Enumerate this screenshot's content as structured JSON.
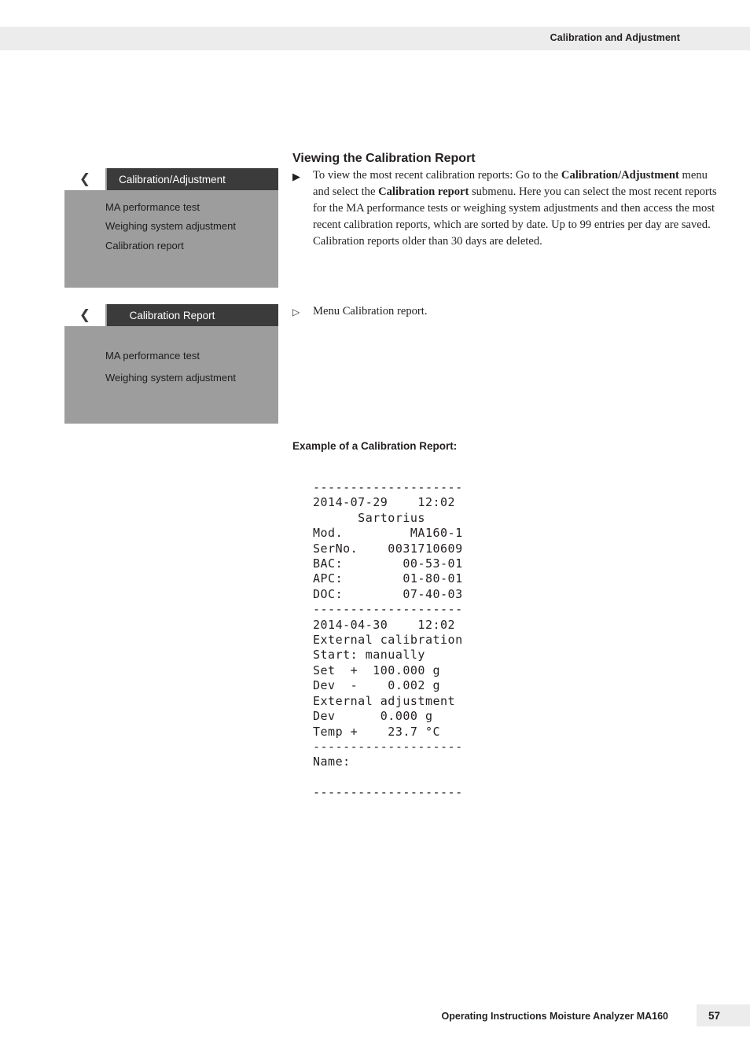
{
  "header": {
    "title": "Calibration and Adjustment"
  },
  "section": {
    "heading": "Viewing the Calibration Report"
  },
  "markers": {
    "filled": "▶",
    "open": "▷"
  },
  "devices": [
    {
      "back_icon": "❮",
      "title": "Calibration/Adjustment",
      "items": [
        "MA performance test",
        "Weighing system adjustment",
        "Calibration report"
      ]
    },
    {
      "back_icon": "❮",
      "title": "Calibration Report",
      "items": [
        "MA performance test",
        "Weighing system adjustment"
      ]
    }
  ],
  "paragraphs": {
    "p1_part1": "To view the most recent calibration reports: Go to the ",
    "p1_bold1": "Calibration/Adjustment",
    "p1_part2": " menu and select the ",
    "p1_bold2": "Calibration report",
    "p1_part3": " submenu.",
    "p1_rest": "Here you can select the most recent reports for the MA performance tests or weighing system adjustments and then access the most recent calibration reports, which are sorted by date. Up to 99 entries per day are saved. Calibration reports older than 30 days are deleted.",
    "p2": "Menu Calibration report."
  },
  "example": {
    "label": "Example of a Calibration Report:",
    "printout": "--------------------\n2014-07-29    12:02\n      Sartorius\nMod.         MA160-1\nSerNo.    0031710609\nBAC:        00-53-01\nAPC:        01-80-01\nDOC:        07-40-03\n--------------------\n2014-04-30    12:02\nExternal calibration\nStart: manually\nSet  +  100.000 g\nDev  -    0.002 g\nExternal adjustment\nDev      0.000 g\nTemp +    23.7 °C\n--------------------\nName:\n\n--------------------"
  },
  "footer": {
    "text": "Operating Instructions Moisture Analyzer MA160",
    "page": "57"
  }
}
